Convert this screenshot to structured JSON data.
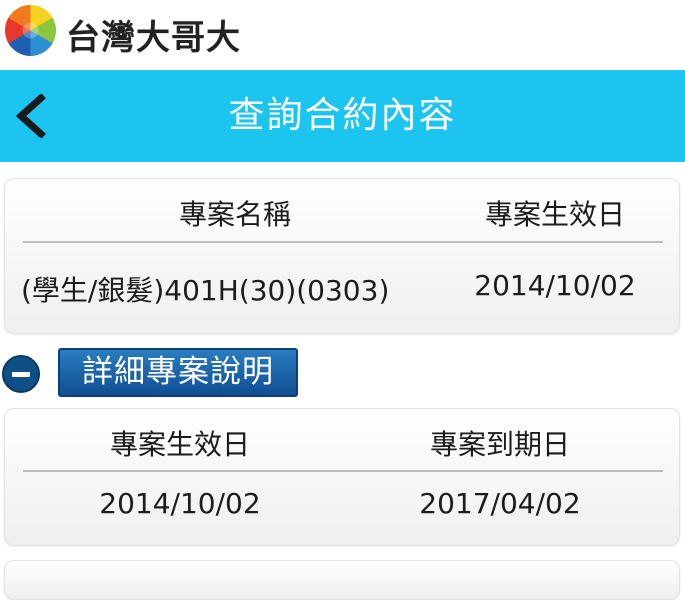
{
  "brand": {
    "name": "台灣大哥大",
    "logo_icon": "taiwan-mobile-logo"
  },
  "header": {
    "title": "查詢合約內容",
    "back_icon": "chevron-left-icon",
    "background": "#1cc4f0"
  },
  "plan_card": {
    "headers": [
      "專案名稱",
      "專案生效日"
    ],
    "values": [
      "(學生/銀髮)401H(30)(0303)",
      "2014/10/02"
    ]
  },
  "details_toggle": {
    "icon": "minus-circle-icon",
    "label": "詳細專案說明"
  },
  "period_card": {
    "headers": [
      "專案生效日",
      "專案到期日"
    ],
    "values": [
      "2014/10/02",
      "2017/04/02"
    ]
  }
}
